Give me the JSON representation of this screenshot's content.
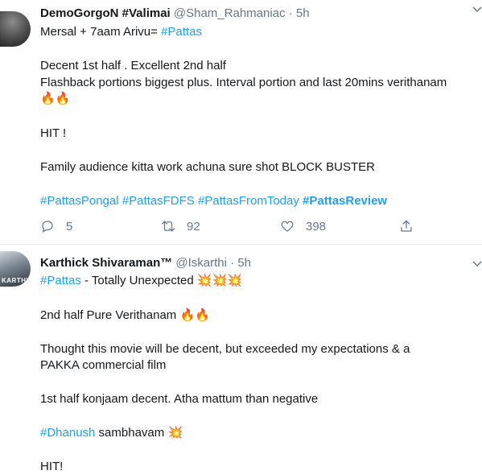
{
  "tweets": [
    {
      "name": "DemoGorgoN #Valimai",
      "handle": "@Sham_Rahmaniac",
      "dot": "·",
      "time": "5h",
      "lines": {
        "l1_text": "Mersal + 7aam Arivu= ",
        "l1_tag": "#Pattas",
        "l2": "Decent 1st half . Excellent 2nd half",
        "l3": "Flashback portions biggest plus. Interval portion and last 20mins verithanam",
        "l4_emoji": "🔥🔥",
        "l5": "HIT !",
        "l6": "Family audience kitta work achuna sure shot BLOCK BUSTER",
        "tag1": "#PattasPongal",
        "tag2": "#PattasFDFS",
        "tag3": "#PattasFromToday",
        "tag4": "#PattasReview"
      },
      "replies": "5",
      "retweets": "92",
      "likes": "398"
    },
    {
      "name": "Karthick Shivaraman™",
      "handle": "@Iskarthi",
      "dot": "·",
      "time": "5h",
      "avatar_text": "KARTHIN",
      "lines": {
        "l1_tag": "#Pattas",
        "l1_text": " - Totally Unexpected ",
        "l1_emoji": "💥💥💥",
        "l2_text": "2nd half Pure Verithanam ",
        "l2_emoji": "🔥🔥",
        "l3": "Thought this movie will be decent, but exceeded my expectations & a",
        "l4": "PAKKA commercial film",
        "l5": "1st half konjaam decent. Atha mattum than negative",
        "l6_tag": "#Dhanush",
        "l6_text": " sambhavam ",
        "l6_emoji": "💥",
        "l7": "HIT!"
      }
    }
  ],
  "colors": {
    "link": "#1da1f2",
    "muted": "#657786",
    "text": "#14171a",
    "divider": "#e6ecf0"
  },
  "icons": [
    "reply-icon",
    "retweet-icon",
    "like-icon",
    "share-icon",
    "chevron-down-icon"
  ]
}
